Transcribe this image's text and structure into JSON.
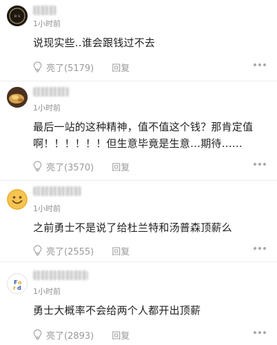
{
  "comments": [
    {
      "time": "1小时前",
      "text": "说现实些..谁会跟钱过不去",
      "likes_label": "亮了(5179)",
      "reply_label": "回复",
      "avatar_icon": "dark-badge-avatar"
    },
    {
      "time": "1小时前",
      "text": "最后一站的这种精神，值不值这个钱？那肯定值啊！！！！！！但生意毕竟是生意…期待……",
      "likes_label": "亮了(3570)",
      "reply_label": "回复",
      "avatar_icon": "food-photo-avatar"
    },
    {
      "time": "1小时前",
      "text": "之前勇士不是说了给杜兰特和汤普森顶薪么",
      "likes_label": "亮了(2555)",
      "reply_label": "回复",
      "avatar_icon": "smiley-face-avatar"
    },
    {
      "time": "1小时前",
      "text": "勇士大概率不会给两个人都开出顶薪",
      "likes_label": "亮了(2893)",
      "reply_label": "回复",
      "avatar_icon": "yellow-logo-avatar"
    }
  ],
  "colors": {
    "meta_text": "#9a9a9a",
    "body_text": "#222222",
    "divider": "#ececec"
  }
}
